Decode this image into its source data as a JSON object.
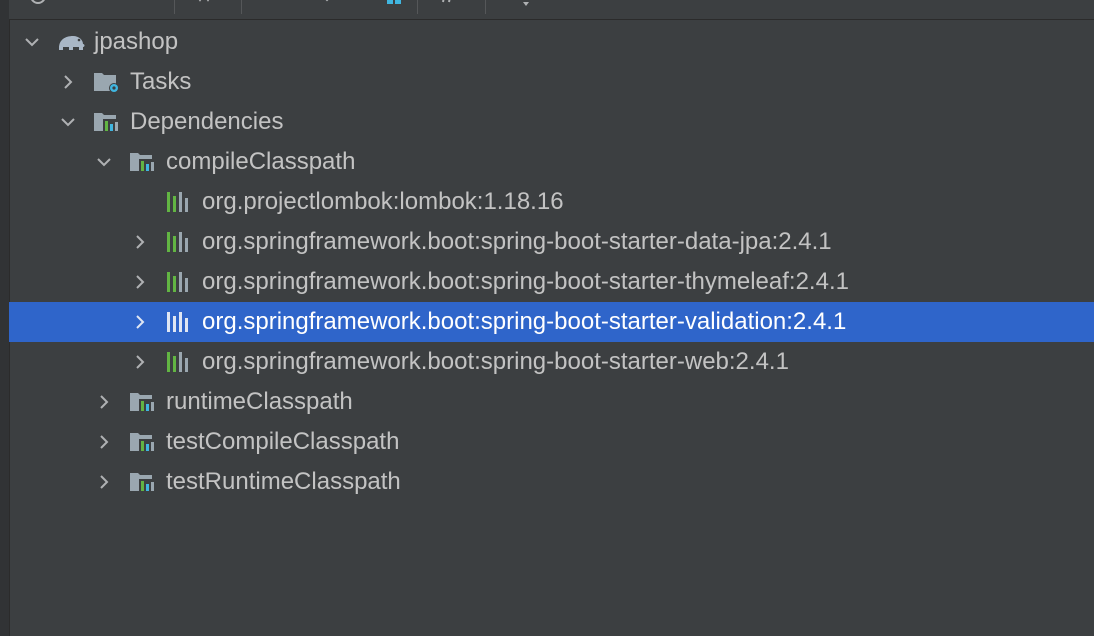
{
  "toolbar": {
    "icons": [
      "refresh-icon",
      "execute-task-icon",
      "collapse-all-icon",
      "expand-all-icon",
      "dependencies-diagram-icon",
      "hash-icon",
      "settings-dropdown-icon"
    ]
  },
  "tree": {
    "root": {
      "label": "jpashop",
      "expanded": true,
      "icon": "gradle-elephant-icon"
    },
    "tasks": {
      "label": "Tasks",
      "expanded": false,
      "icon": "tasks-folder-icon"
    },
    "dependencies": {
      "label": "Dependencies",
      "expanded": true,
      "icon": "dependencies-folder-icon"
    },
    "compile_classpath": {
      "label": "compileClasspath",
      "expanded": true,
      "icon": "configuration-icon"
    },
    "deps": [
      {
        "label": "org.projectlombok:lombok:1.18.16",
        "has_children": false
      },
      {
        "label": "org.springframework.boot:spring-boot-starter-data-jpa:2.4.1",
        "has_children": true
      },
      {
        "label": "org.springframework.boot:spring-boot-starter-thymeleaf:2.4.1",
        "has_children": true
      },
      {
        "label": "org.springframework.boot:spring-boot-starter-validation:2.4.1",
        "has_children": true,
        "selected": true
      },
      {
        "label": "org.springframework.boot:spring-boot-starter-web:2.4.1",
        "has_children": true
      }
    ],
    "runtime_classpath": {
      "label": "runtimeClasspath",
      "expanded": false
    },
    "test_compile_classpath": {
      "label": "testCompileClasspath",
      "expanded": false
    },
    "test_runtime_classpath": {
      "label": "testRuntimeClasspath",
      "expanded": false
    }
  },
  "colors": {
    "background": "#3c3f41",
    "selection": "#2f65ca",
    "text": "#c3c3c3",
    "icon_green": "#62b543",
    "icon_blue": "#40b6e0",
    "folder_gray": "#9aa7b0"
  }
}
